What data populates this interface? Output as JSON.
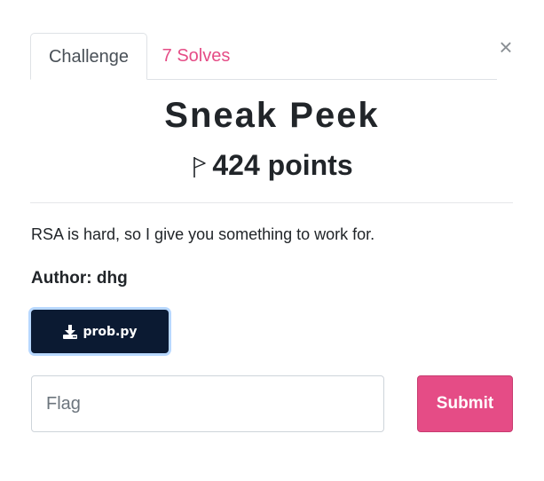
{
  "tabs": {
    "challenge_label": "Challenge",
    "solves_label": "7 Solves"
  },
  "close_symbol": "×",
  "challenge": {
    "name": "Sneak Peek",
    "points": "424 points",
    "description": "RSA is hard, so I give you something to work for.",
    "author": "Author: dhg",
    "file_name": "prob.py"
  },
  "flag_input": {
    "placeholder": "Flag",
    "value": ""
  },
  "submit_label": "Submit",
  "icons": {
    "points": "flag-icon",
    "file": "download-icon",
    "close": "close-icon"
  },
  "colors": {
    "accent": "#e54c86",
    "file_button": "#0b1a32",
    "file_button_focus": "#b8d8ff"
  }
}
